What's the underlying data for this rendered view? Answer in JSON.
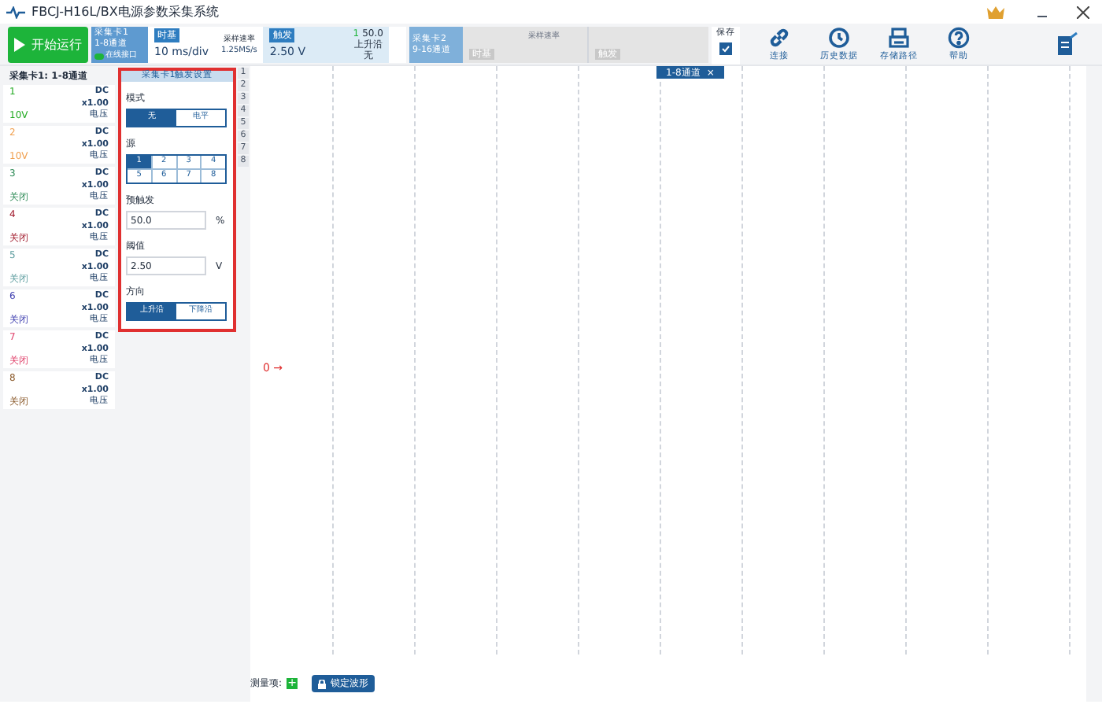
{
  "window": {
    "title": "FBCJ-H16L/BX电源参数采集系统"
  },
  "toolbar": {
    "start_button": "开始运行",
    "card1": {
      "title": "采集卡1",
      "channels": "1-8通道",
      "toggle": "在线接口",
      "timebase_label": "时基",
      "timebase": "10 ms/div",
      "rate_label": "采样速率",
      "rate": "1.25MS/s",
      "trigger_label": "触发",
      "trigger": "2.50 V",
      "trig_channel": "1",
      "trig_percent": "50.0",
      "trig_edge": "上升沿",
      "trig_extra": "无"
    },
    "card2": {
      "title": "采集卡2",
      "channels": "9-16通道",
      "timebase_label": "时基",
      "rate_label": "采样速率",
      "trigger_label": "触发"
    },
    "save": {
      "label": "保存",
      "checked": true
    },
    "actions": [
      {
        "label": "连接"
      },
      {
        "label": "历史数据"
      },
      {
        "label": "存储路径"
      },
      {
        "label": "帮助"
      }
    ]
  },
  "channel_panel": {
    "title": "采集卡1: 1-8通道",
    "channels": [
      {
        "number": "1",
        "coupling": "DC",
        "scale": "x1.00",
        "type": "电压",
        "value": "10V",
        "color": "#22aa22"
      },
      {
        "number": "2",
        "coupling": "DC",
        "scale": "x1.00",
        "type": "电压",
        "value": "10V",
        "color": "#f0a050"
      },
      {
        "number": "3",
        "coupling": "DC",
        "scale": "x1.00",
        "type": "电压",
        "value": "关闭",
        "color": "#2e8b57"
      },
      {
        "number": "4",
        "coupling": "DC",
        "scale": "x1.00",
        "type": "电压",
        "value": "关闭",
        "color": "#a0182a"
      },
      {
        "number": "5",
        "coupling": "DC",
        "scale": "x1.00",
        "type": "电压",
        "value": "关闭",
        "color": "#5f9ea0"
      },
      {
        "number": "6",
        "coupling": "DC",
        "scale": "x1.00",
        "type": "电压",
        "value": "关闭",
        "color": "#4040b0"
      },
      {
        "number": "7",
        "coupling": "DC",
        "scale": "x1.00",
        "type": "电压",
        "value": "关闭",
        "color": "#e0406a"
      },
      {
        "number": "8",
        "coupling": "DC",
        "scale": "x1.00",
        "type": "电压",
        "value": "关闭",
        "color": "#8b5a2b"
      }
    ]
  },
  "trigger_panel": {
    "title": "采集卡1触发设置",
    "mode_label": "模式",
    "modes": [
      {
        "label": "无",
        "selected": true
      },
      {
        "label": "电平",
        "selected": false
      }
    ],
    "source_label": "源",
    "sources": [
      {
        "label": "1",
        "selected": true
      },
      {
        "label": "2",
        "selected": false
      },
      {
        "label": "3",
        "selected": false
      },
      {
        "label": "4",
        "selected": false
      },
      {
        "label": "5",
        "selected": false
      },
      {
        "label": "6",
        "selected": false
      },
      {
        "label": "7",
        "selected": false
      },
      {
        "label": "8",
        "selected": false
      }
    ],
    "pretrigger_label": "预触发",
    "pretrigger": "50.0",
    "pretrigger_unit": "%",
    "threshold_label": "阈值",
    "threshold": "2.50",
    "threshold_unit": "V",
    "direction_label": "方向",
    "directions": [
      {
        "label": "上升沿",
        "selected": true
      },
      {
        "label": "下降沿",
        "selected": false
      }
    ]
  },
  "side_tabs": [
    "1",
    "2",
    "3",
    "4",
    "5",
    "6",
    "7",
    "8"
  ],
  "chart": {
    "tab": "1-8通道",
    "tab_close": "×",
    "zero_marker": "0 →"
  },
  "bottom": {
    "measure_label": "测量项:",
    "measure_add": "+",
    "lock_button": "锁定波形"
  }
}
